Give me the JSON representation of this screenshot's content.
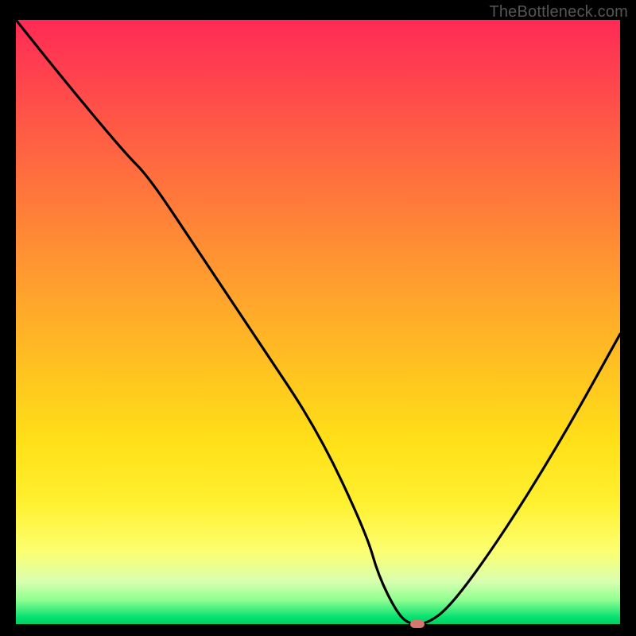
{
  "watermark": "TheBottleneck.com",
  "chart_data": {
    "type": "line",
    "title": "",
    "xlabel": "",
    "ylabel": "",
    "xlim": [
      0,
      100
    ],
    "ylim": [
      0,
      100
    ],
    "series": [
      {
        "name": "bottleneck-curve",
        "x": [
          0,
          8,
          18,
          22,
          30,
          40,
          50,
          58,
          60,
          63,
          65,
          68,
          72,
          80,
          90,
          100
        ],
        "values": [
          100,
          90,
          78,
          74,
          62,
          47,
          32,
          15,
          8,
          2,
          0,
          0,
          3,
          14,
          30,
          48
        ]
      }
    ],
    "marker": {
      "x": 66.5,
      "y": 0,
      "color": "#d6776f"
    },
    "gradient_stops": [
      {
        "pos": 0,
        "color": "#ff2a55"
      },
      {
        "pos": 50,
        "color": "#ffb020"
      },
      {
        "pos": 80,
        "color": "#fff030"
      },
      {
        "pos": 100,
        "color": "#00d060"
      }
    ]
  }
}
